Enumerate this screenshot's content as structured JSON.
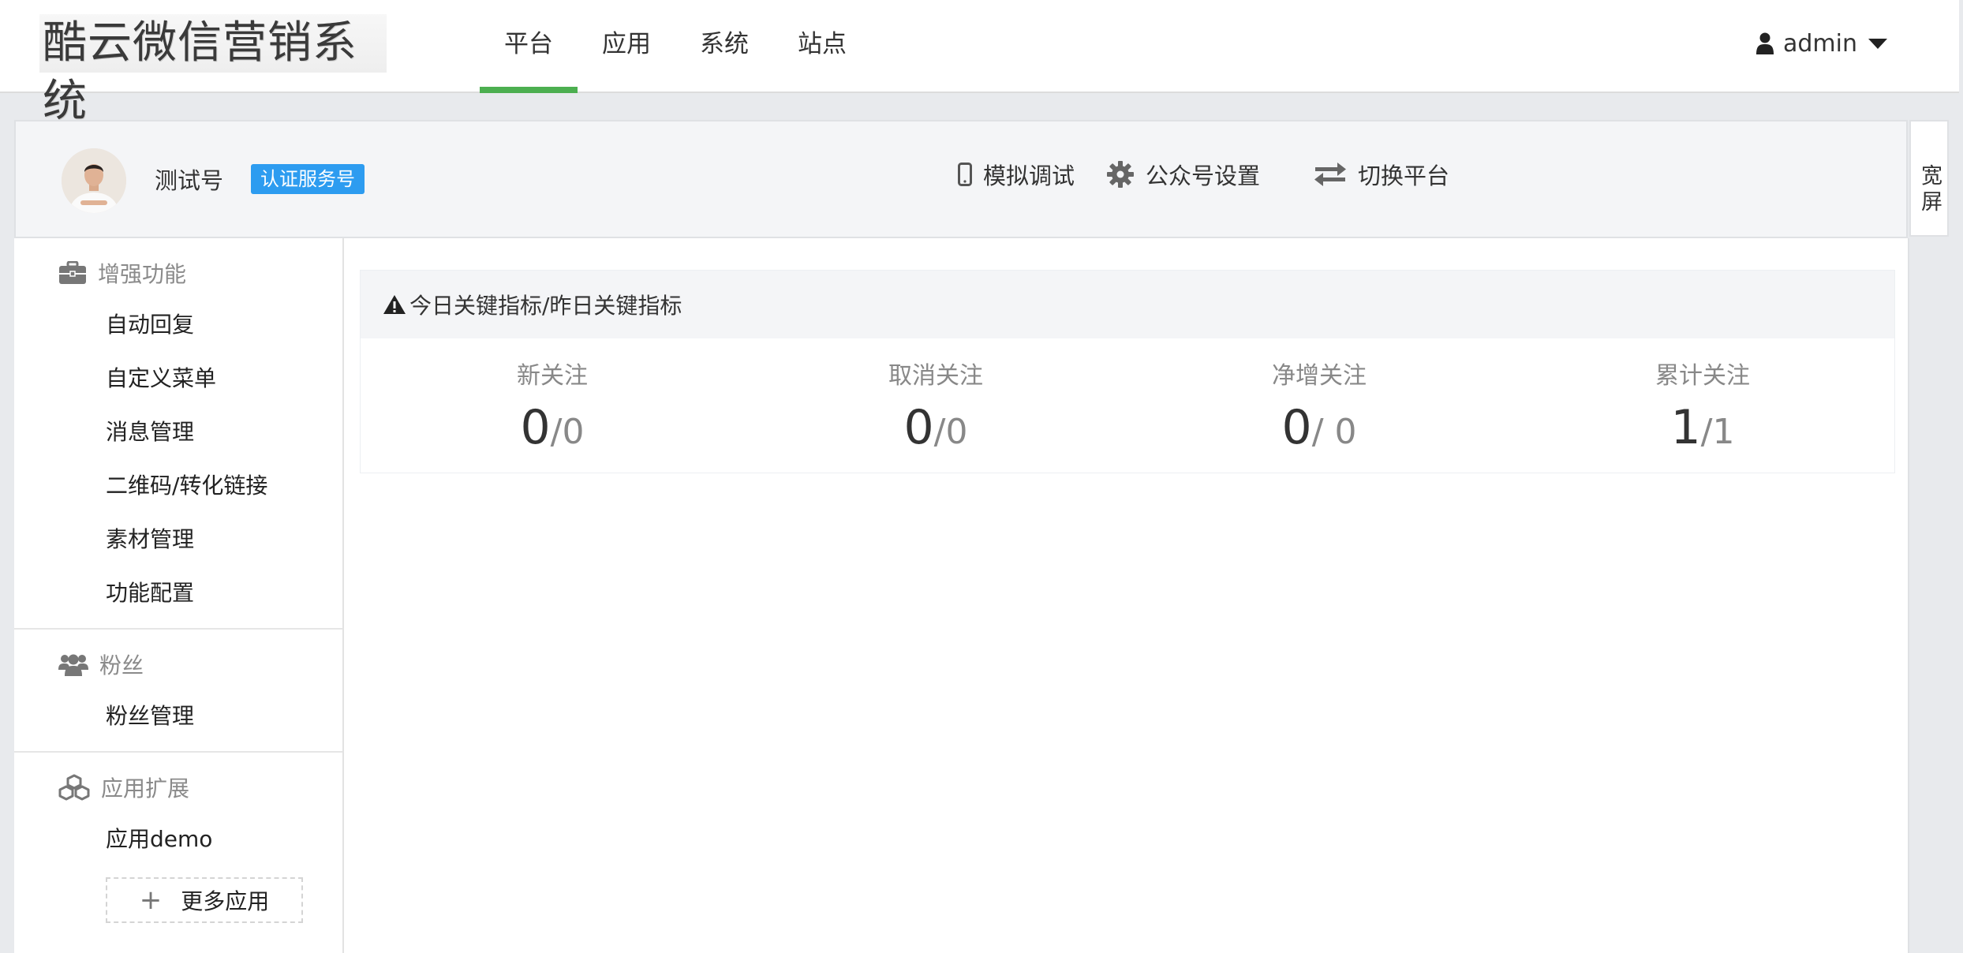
{
  "navbar": {
    "brand": "酷云微信营销系统",
    "tabs": [
      {
        "label": "平台",
        "active": true
      },
      {
        "label": "应用",
        "active": false
      },
      {
        "label": "系统",
        "active": false
      },
      {
        "label": "站点",
        "active": false
      }
    ],
    "user": {
      "name": "admin",
      "icon": "user-icon"
    },
    "accent_color": "#4caf50"
  },
  "account": {
    "name": "测试号",
    "badge": "认证服务号",
    "badge_color": "#2d9cf0",
    "actions": [
      {
        "label": "模拟调试",
        "icon": "mobile-icon"
      },
      {
        "label": "公众号设置",
        "icon": "gear-icon"
      },
      {
        "label": "切换平台",
        "icon": "exchange-icon"
      }
    ],
    "wide_toggle": "宽屏"
  },
  "sidebar": {
    "groups": [
      {
        "title": "增强功能",
        "icon": "briefcase-icon",
        "items": [
          "自动回复",
          "自定义菜单",
          "消息管理",
          "二维码/转化链接",
          "素材管理",
          "功能配置"
        ]
      },
      {
        "title": "粉丝",
        "icon": "users-icon",
        "items": [
          "粉丝管理"
        ]
      },
      {
        "title": "应用扩展",
        "icon": "cubes-icon",
        "items": [
          "应用demo"
        ]
      }
    ],
    "more_apps": {
      "plus": "+",
      "label": "更多应用"
    }
  },
  "metrics_panel": {
    "title": "今日关键指标/昨日关键指标",
    "icon": "warning-icon",
    "metrics": [
      {
        "label": "新关注",
        "today": "0",
        "yesterday": "/0"
      },
      {
        "label": "取消关注",
        "today": "0",
        "yesterday": "/0"
      },
      {
        "label": "净增关注",
        "today": "0",
        "yesterday": "/ 0"
      },
      {
        "label": "累计关注",
        "today": "1",
        "yesterday": "/1"
      }
    ]
  }
}
